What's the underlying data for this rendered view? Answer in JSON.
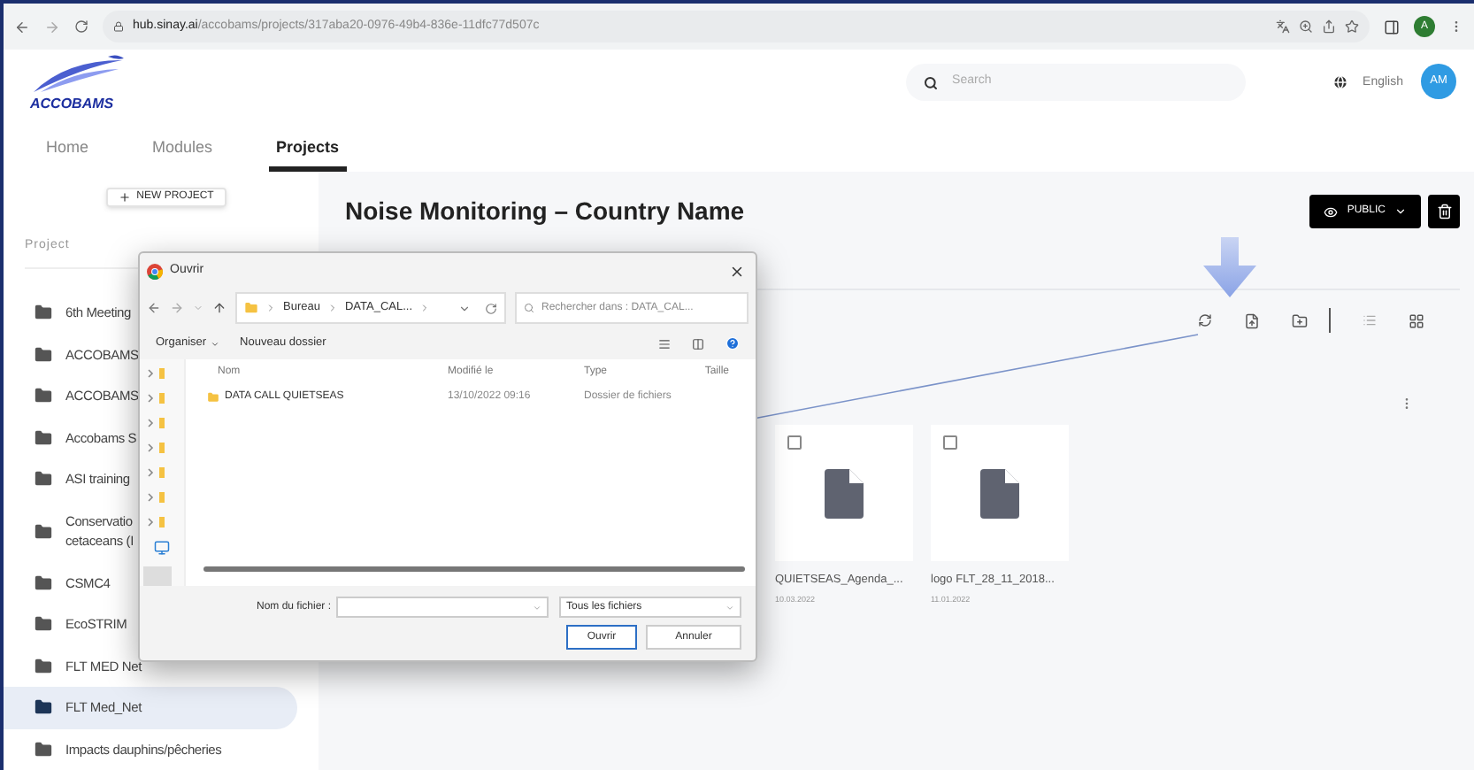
{
  "browser": {
    "url_host": "hub.sinay.ai",
    "url_path": "/accobams/projects/317aba20-0976-49b4-836e-11dfc77d507c",
    "profile": "A"
  },
  "header": {
    "logo": "ACCOBAMS",
    "search_placeholder": "Search",
    "language": "English",
    "avatar": "AM"
  },
  "nav": [
    {
      "label": "Home",
      "selected": false
    },
    {
      "label": "Modules",
      "selected": false
    },
    {
      "label": "Projects",
      "selected": true
    }
  ],
  "sidebar": {
    "new_button": "NEW PROJECT",
    "heading": "Project",
    "items": [
      {
        "label": "6th Meeting",
        "selected": false
      },
      {
        "label": "ACCOBAMS",
        "selected": false
      },
      {
        "label": "ACCOBAMS",
        "selected": false
      },
      {
        "label": "Accobams S",
        "selected": false
      },
      {
        "label": "ASI training",
        "selected": false
      },
      {
        "label": "Conservatio\ncetaceans (I",
        "selected": false
      },
      {
        "label": "CSMC4",
        "selected": false
      },
      {
        "label": "EcoSTRIM",
        "selected": false
      },
      {
        "label": "FLT MED Net",
        "selected": false
      },
      {
        "label": "FLT Med_Net",
        "selected": true
      },
      {
        "label": "Impacts dauphins/pêcheries",
        "selected": false
      }
    ]
  },
  "content": {
    "title": "Noise Monitoring – Country Name",
    "visibility_button": "PUBLIC",
    "files": [
      {
        "name": "QUIETSEAS_Agenda_...",
        "date": "10.03.2022",
        "checked": false
      },
      {
        "name": "logo FLT_28_11_2018...",
        "date": "11.01.2022",
        "checked": false
      }
    ]
  },
  "dialog": {
    "title": "Ouvrir",
    "breadcrumb": [
      "Bureau",
      "DATA_CAL..."
    ],
    "search_placeholder": "Rechercher dans : DATA_CAL...",
    "organise": "Organiser",
    "new_folder": "Nouveau dossier",
    "columns": [
      "Nom",
      "Modifié le",
      "Type",
      "Taille"
    ],
    "rows": [
      {
        "name": "DATA CALL QUIETSEAS",
        "modified": "13/10/2022 09:16",
        "type": "Dossier de fichiers"
      }
    ],
    "filename_label": "Nom du fichier :",
    "filter": "Tous les fichiers",
    "buttons": [
      {
        "label": "Ouvrir",
        "kind": "primary"
      },
      {
        "label": "Annuler",
        "kind": "secondary"
      }
    ]
  }
}
